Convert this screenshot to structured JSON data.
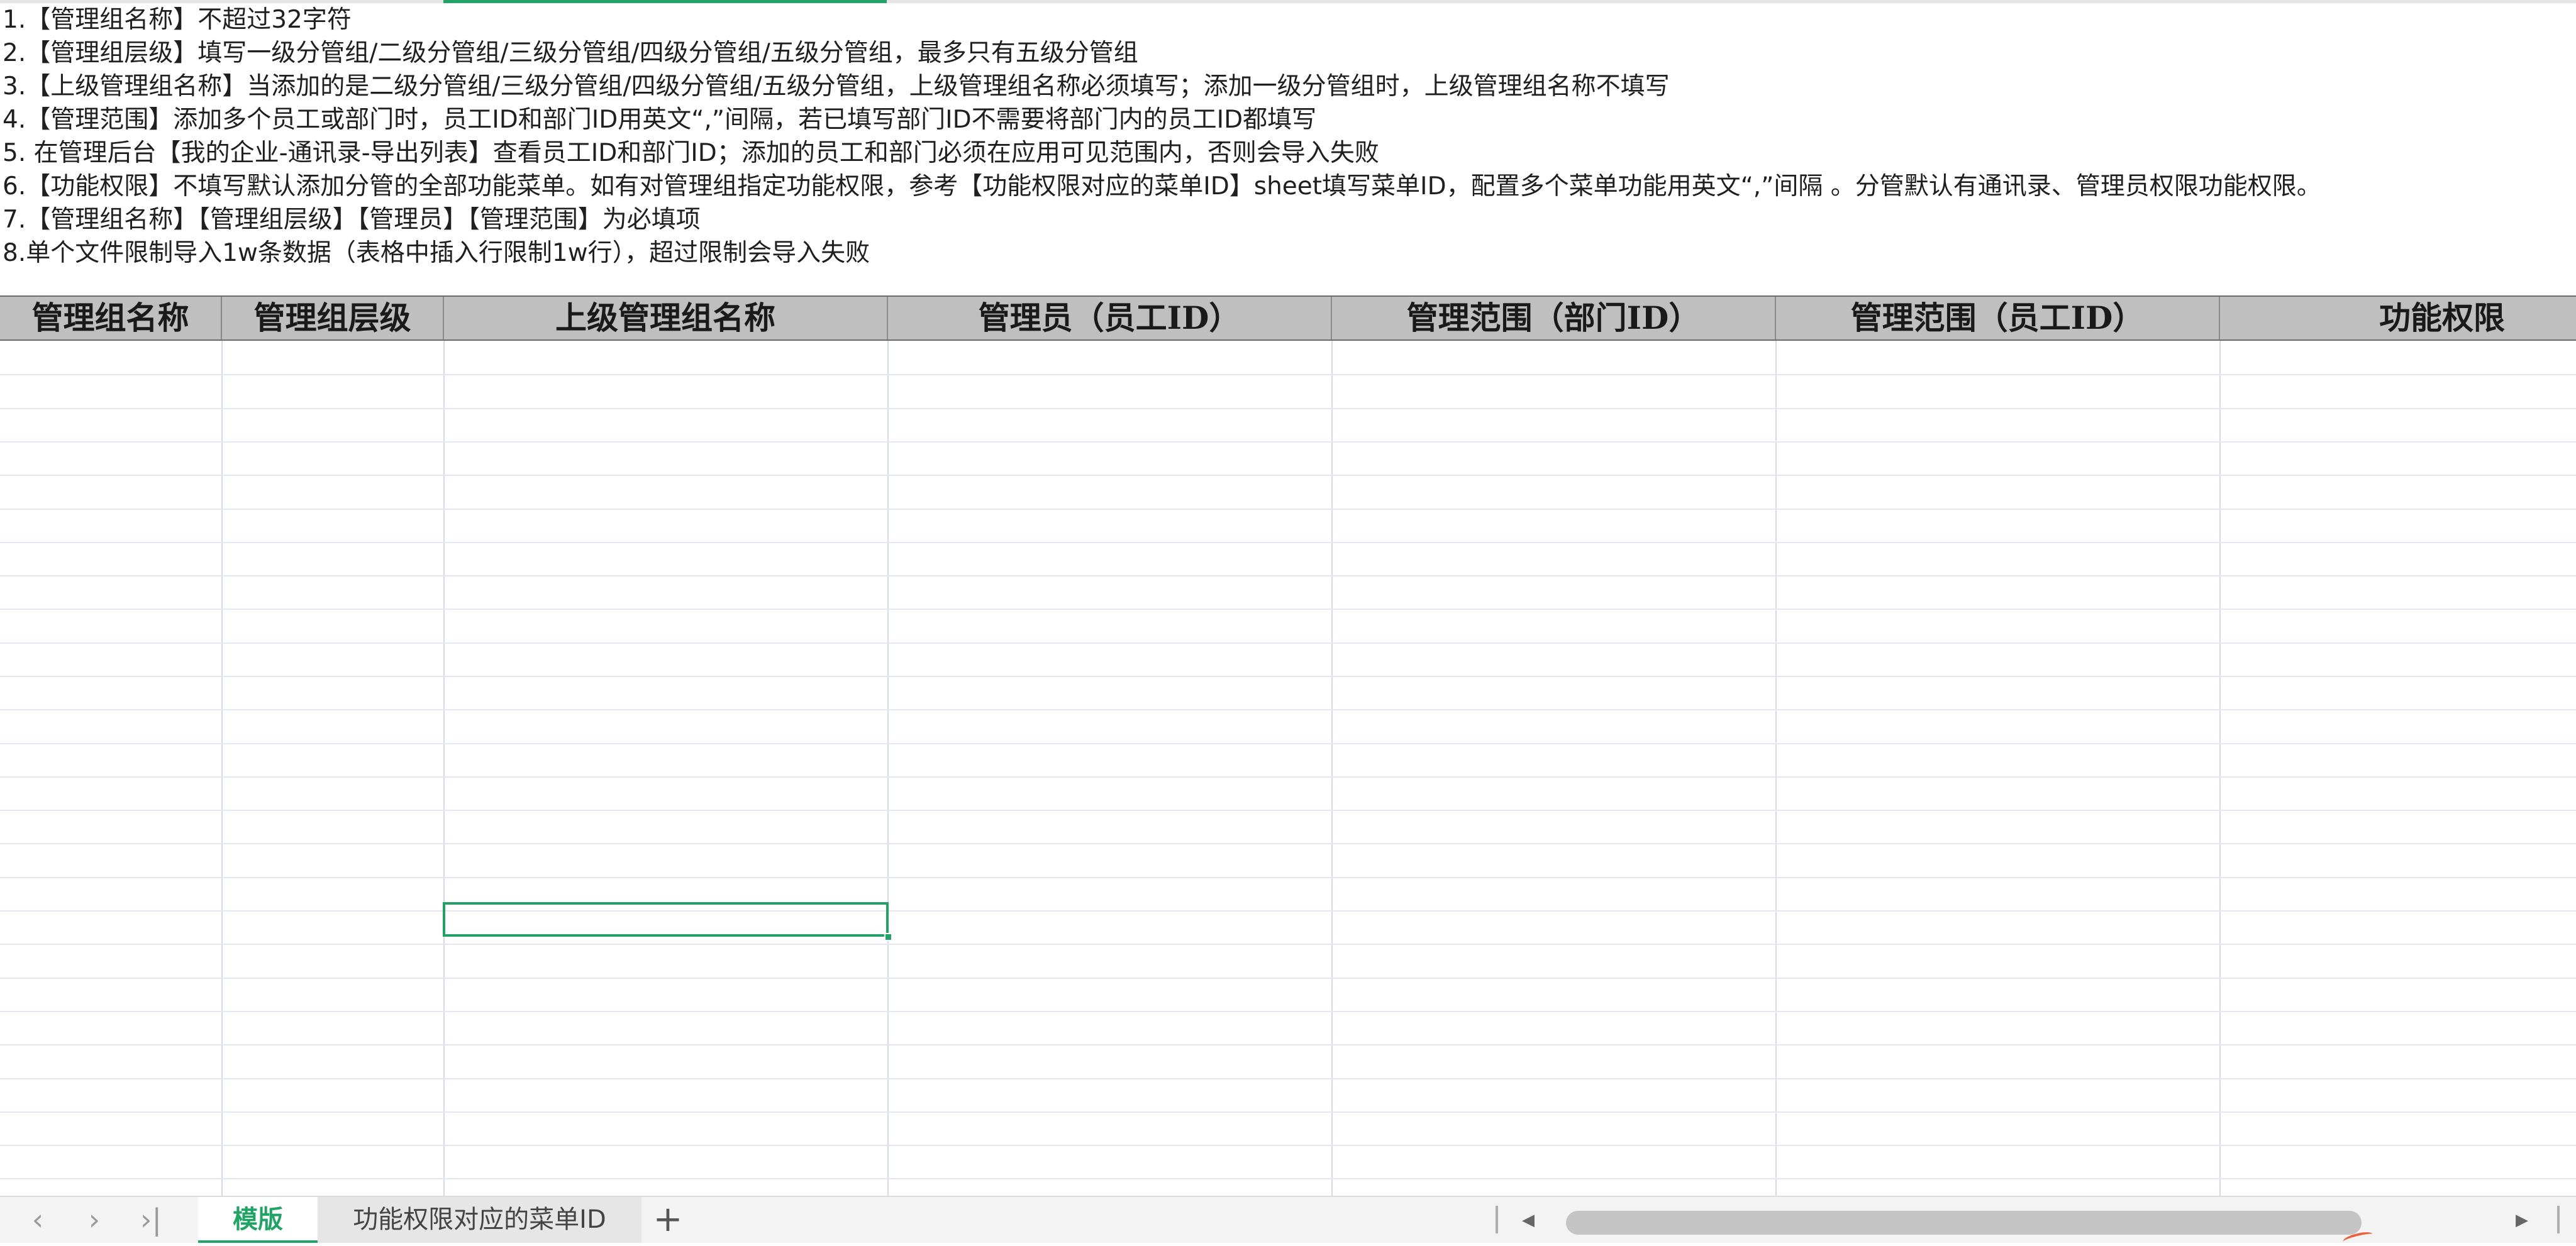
{
  "notes": [
    "1.【管理组名称】不超过32字符",
    "2.【管理组层级】填写一级分管组/二级分管组/三级分管组/四级分管组/五级分管组，最多只有五级分管组",
    "3.【上级管理组名称】当添加的是二级分管组/三级分管组/四级分管组/五级分管组，上级管理组名称必须填写；添加一级分管组时，上级管理组名称不填写",
    "4.【管理范围】添加多个员工或部门时，员工ID和部门ID用英文“,”间隔，若已填写部门ID不需要将部门内的员工ID都填写",
    "5. 在管理后台【我的企业-通讯录-导出列表】查看员工ID和部门ID；添加的员工和部门必须在应用可见范围内，否则会导入失败",
    "6.【功能权限】不填写默认添加分管的全部功能菜单。如有对管理组指定功能权限，参考【功能权限对应的菜单ID】sheet填写菜单ID，配置多个菜单功能用英文“,”间隔 。分管默认有通讯录、管理员权限功能权限。",
    "7.【管理组名称】【管理组层级】【管理员】【管理范围】为必填项",
    "8.单个文件限制导入1w条数据（表格中插入行限制1w行），超过限制会导入失败"
  ],
  "headers": [
    "管理组名称",
    "管理组层级",
    "上级管理组名称",
    "管理员（员工ID）",
    "管理范围（部门ID）",
    "管理范围（员工ID）",
    "功能权限"
  ],
  "tabs": {
    "active": "模版",
    "second": "功能权限对应的菜单ID"
  },
  "icons": {
    "first_sheet": "chevron-left-icon",
    "next_sheet": "chevron-right-icon",
    "last_sheet": "chevron-last-icon",
    "add_sheet": "plus-icon"
  },
  "colors": {
    "accent": "#21a366",
    "header_bg": "#bfbfbf"
  }
}
